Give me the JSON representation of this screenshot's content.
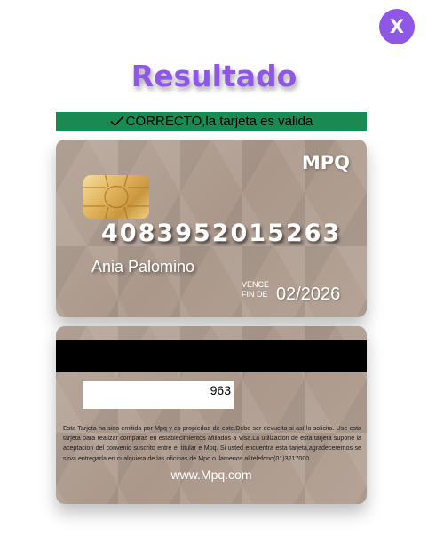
{
  "close_button": {
    "label": "X"
  },
  "title": "Resultado",
  "status": {
    "text": "CORRECTO,la tarjeta es valida",
    "icon": "checkmark-icon",
    "color": "#1a8a52"
  },
  "card_front": {
    "brand": "MPQ",
    "chip_icon": "chip-icon",
    "number": "4083952015263",
    "holder_name": "Ania Palomino",
    "expiry_label_line1": "VENCE",
    "expiry_label_line2": "FIN DE",
    "expiry": "02/2026"
  },
  "card_back": {
    "cvv": "963",
    "terms": "Esta Tarjeta ha sido emitida por Mpq y es propiedad de este.Debe ser devuelta si así lo solicita. Use esta tarjeta para realizar comparas en establecimientos afiliados a Visa.La utilizacion de esta tarjeta supone la aceptacion del convenio suscrito entre el titular e Mpq. Si usted encuentra esta tarjeta,agradeceremos se sirva entregarla en cualquiera de las oficinas de Mpq o llamenos al telefono(01)3217000.",
    "website": "www.Mpq.com"
  },
  "colors": {
    "accent": "#8e57e6",
    "card": "#b3a195",
    "success": "#1a8a52"
  }
}
